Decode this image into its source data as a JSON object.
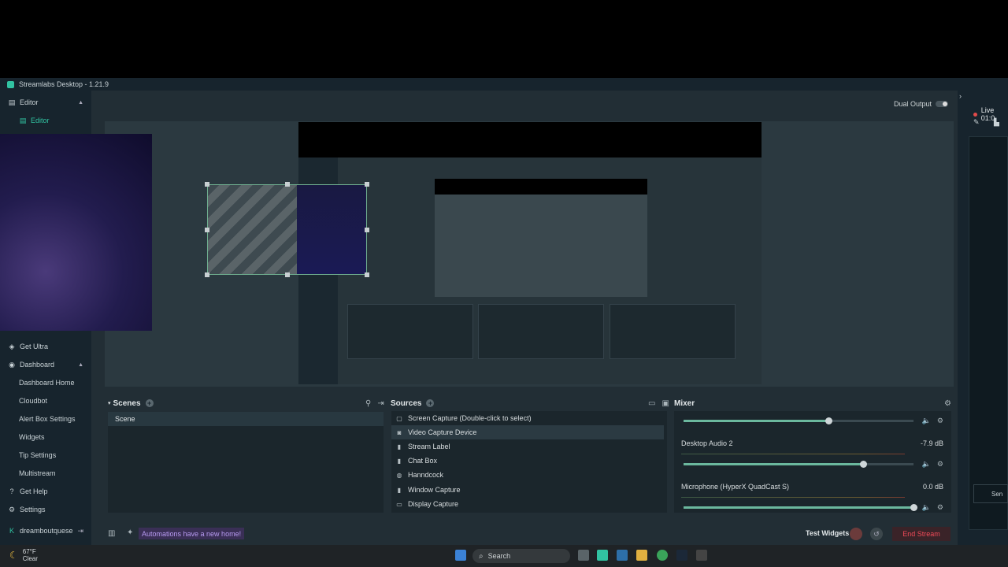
{
  "titlebar": {
    "title": "Streamlabs Desktop - 1.21.9"
  },
  "sidebar": {
    "editor_section": "Editor",
    "editor_item": "Editor",
    "get_ultra": "Get Ultra",
    "dashboard_section": "Dashboard",
    "dashboard_items": [
      "Dashboard Home",
      "Cloudbot",
      "Alert Box Settings",
      "Widgets",
      "Tip Settings",
      "Multistream"
    ],
    "get_help": "Get Help",
    "settings": "Settings",
    "username": "dreamboutquese"
  },
  "header": {
    "dual_output": "Dual Output"
  },
  "scenes": {
    "title": "Scenes",
    "items": [
      "Scene"
    ]
  },
  "sources": {
    "title": "Sources",
    "items": [
      {
        "label": "Screen Capture (Double-click to select)",
        "icon": "screen-icon"
      },
      {
        "label": "Video Capture Device",
        "icon": "camera-icon"
      },
      {
        "label": "Stream Label",
        "icon": "file-icon"
      },
      {
        "label": "Chat Box",
        "icon": "file-icon"
      },
      {
        "label": "Hanndcock",
        "icon": "globe-icon"
      },
      {
        "label": "Window Capture",
        "icon": "file-icon"
      },
      {
        "label": "Display Capture",
        "icon": "monitor-icon"
      }
    ]
  },
  "mixer": {
    "title": "Mixer",
    "tracks": [
      {
        "name": "",
        "db": "",
        "level": 0.63
      },
      {
        "name": "Desktop Audio 2",
        "db": "-7.9 dB",
        "level": 0.78
      },
      {
        "name": "Microphone (HyperX QuadCast S)",
        "db": "0.0 dB",
        "level": 1.0
      }
    ]
  },
  "footer": {
    "automations": "Automations have a new home!",
    "test_widgets": "Test Widgets",
    "end_stream": "End Stream"
  },
  "right_panel": {
    "live": "Live 01:0",
    "send": "Sen"
  },
  "taskbar": {
    "temp": "67°F",
    "condition": "Clear",
    "search": "Search"
  },
  "colors": {
    "accent": "#31c3a2",
    "danger": "#f04a58",
    "bg": "#17242d"
  }
}
